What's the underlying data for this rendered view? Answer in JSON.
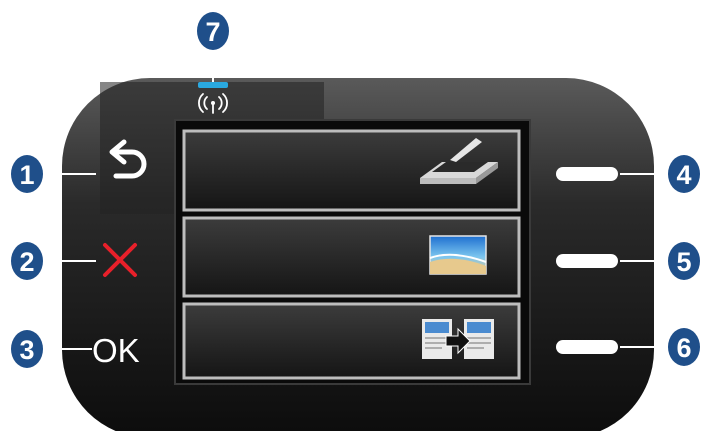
{
  "panel": {
    "buttons": {
      "back": {
        "icon": "back-arrow-icon"
      },
      "cancel": {
        "icon": "x-icon",
        "color": "#e8202a"
      },
      "ok": {
        "label": "OK"
      }
    },
    "wireless": {
      "icon": "wireless-icon",
      "light_color": "#2aa9e0"
    },
    "display": {
      "rows": [
        {
          "icon": "scanner-icon"
        },
        {
          "icon": "photo-icon"
        },
        {
          "icon": "copy-icon"
        }
      ]
    },
    "selection_buttons": 3
  },
  "callouts": {
    "color": "#1f4f8a",
    "labels": [
      "1",
      "2",
      "3",
      "4",
      "5",
      "6",
      "7"
    ]
  }
}
